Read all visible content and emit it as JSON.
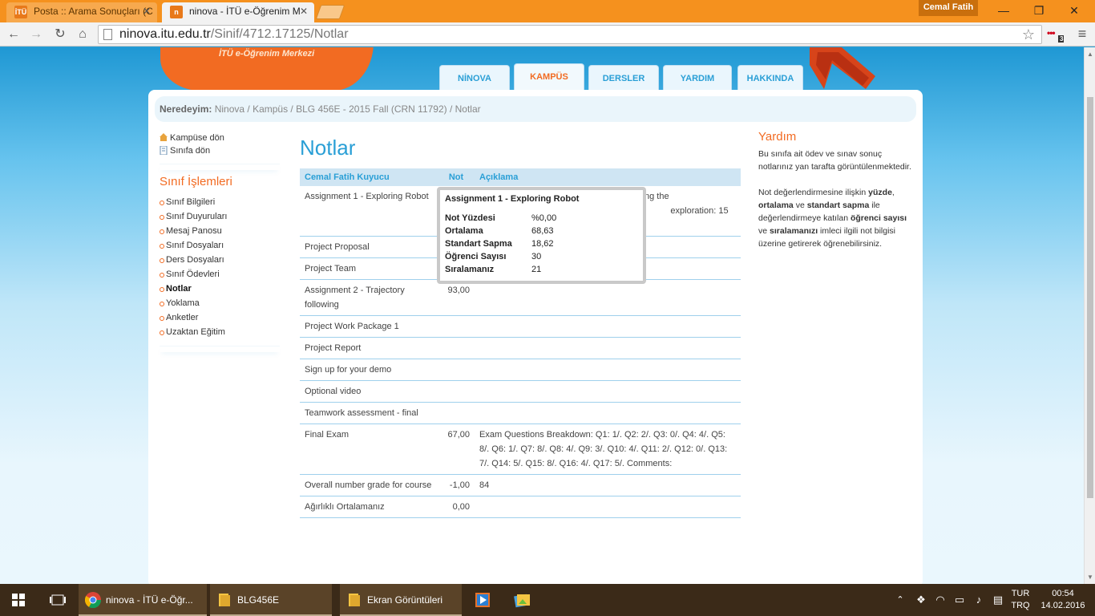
{
  "browser": {
    "tabs": [
      {
        "title": "Posta :: Arama Sonuçları (C",
        "favicon": "İTÜ",
        "active": false
      },
      {
        "title": "ninova - İTÜ e-Öğrenim M",
        "favicon": "n",
        "active": true
      }
    ],
    "user": "Cemal Fatih",
    "window_buttons": {
      "minimize": "—",
      "maximize": "❐",
      "close": "✕"
    },
    "nav": {
      "back": "←",
      "forward": "→",
      "reload": "↻",
      "home": "⌂"
    },
    "url_host": "ninova.itu.edu.tr",
    "url_path": "/Sinif/4712.17125/Notlar",
    "bookmark_icon": "☆",
    "extension_badge": "3",
    "menu_icon": "≡"
  },
  "site": {
    "logo_subtitle": "İTÜ e-Öğrenim Merkezi",
    "nav": [
      "NİNOVA",
      "KAMPÜS",
      "DERSLER",
      "YARDIM",
      "HAKKINDA"
    ],
    "nav_selected": "KAMPÜS",
    "colors": {
      "accent_orange": "#f26b22",
      "accent_blue": "#2a9fd6"
    }
  },
  "breadcrumb": {
    "label": "Neredeyim:",
    "path": "Ninova / Kampüs / BLG 456E - 2015 Fall (CRN 11792) / Notlar"
  },
  "sidebar": {
    "links": [
      "Kampüse dön",
      "Sınıfa dön"
    ],
    "section_title": "Sınıf İşlemleri",
    "items": [
      "Sınıf Bilgileri",
      "Sınıf Duyuruları",
      "Mesaj Panosu",
      "Sınıf Dosyaları",
      "Ders Dosyaları",
      "Sınıf Ödevleri",
      "Notlar",
      "Yoklama",
      "Anketler",
      "Uzaktan Eğitim"
    ],
    "current": "Notlar"
  },
  "main": {
    "title": "Notlar",
    "table": {
      "headers": [
        "Cemal Fatih Kuyucu",
        "Not",
        "Açıklama"
      ],
      "rows": [
        {
          "name": "Assignment 1 - Exploring Robot",
          "not": "",
          "aciklama": "                                               can: 10 Moving the                                                 object avoidance: 0                                               exploration: 15                                                ing the map: 0 Clear"
        },
        {
          "name": "Project Proposal",
          "not": "",
          "aciklama": ""
        },
        {
          "name": "Project Team",
          "not": "",
          "aciklama": ""
        },
        {
          "name": "Assignment 2 - Trajectory following",
          "not": "93,00",
          "aciklama": ""
        },
        {
          "name": "Project Work Package 1",
          "not": "",
          "aciklama": ""
        },
        {
          "name": "Project Report",
          "not": "",
          "aciklama": ""
        },
        {
          "name": "Sign up for your demo",
          "not": "",
          "aciklama": ""
        },
        {
          "name": "Optional video",
          "not": "",
          "aciklama": ""
        },
        {
          "name": "Teamwork assessment - final",
          "not": "",
          "aciklama": ""
        },
        {
          "name": "Final Exam",
          "not": "67,00",
          "aciklama": "Exam Questions Breakdown: Q1: 1/. Q2: 2/. Q3: 0/. Q4: 4/. Q5: 8/. Q6: 1/. Q7: 8/. Q8: 4/. Q9: 3/. Q10: 4/. Q11: 2/. Q12: 0/. Q13: 7/. Q14: 5/. Q15: 8/. Q16: 4/. Q17: 5/. Comments:"
        },
        {
          "name": "Overall number grade for course",
          "not": "-1,00",
          "aciklama": "84"
        },
        {
          "name": "Ağırlıklı Ortalamanız",
          "not": "0,00",
          "aciklama": ""
        }
      ]
    },
    "tooltip": {
      "title": "Assignment 1 - Exploring Robot",
      "rows": [
        {
          "k": "Not Yüzdesi",
          "v": "%0,00"
        },
        {
          "k": "Ortalama",
          "v": "68,63"
        },
        {
          "k": "Standart Sapma",
          "v": "18,62"
        },
        {
          "k": "Öğrenci Sayısı",
          "v": "30"
        },
        {
          "k": "Sıralamanız",
          "v": "21"
        }
      ]
    }
  },
  "help": {
    "title": "Yardım",
    "p1": "Bu sınıfa ait ödev ve sınav sonuç notlarınız yan tarafta görüntülenmektedir.",
    "p2_parts": [
      "Not değerlendirmesine ilişkin ",
      "yüzde",
      ", ",
      "ortalama",
      " ve ",
      "standart sapma",
      " ile değerlendirmeye katılan ",
      "öğrenci sayısı",
      " ve ",
      "sıralamanızı",
      " imleci ilgili not bilgisi üzerine getirerek öğrenebilirsiniz."
    ]
  },
  "taskbar": {
    "items": [
      "ninova - İTÜ e-Öğr...",
      "BLG456E",
      "Ekran Görüntüleri"
    ],
    "lang": [
      "TUR",
      "TRQ"
    ],
    "time": "00:54",
    "date": "14.02.2016"
  }
}
